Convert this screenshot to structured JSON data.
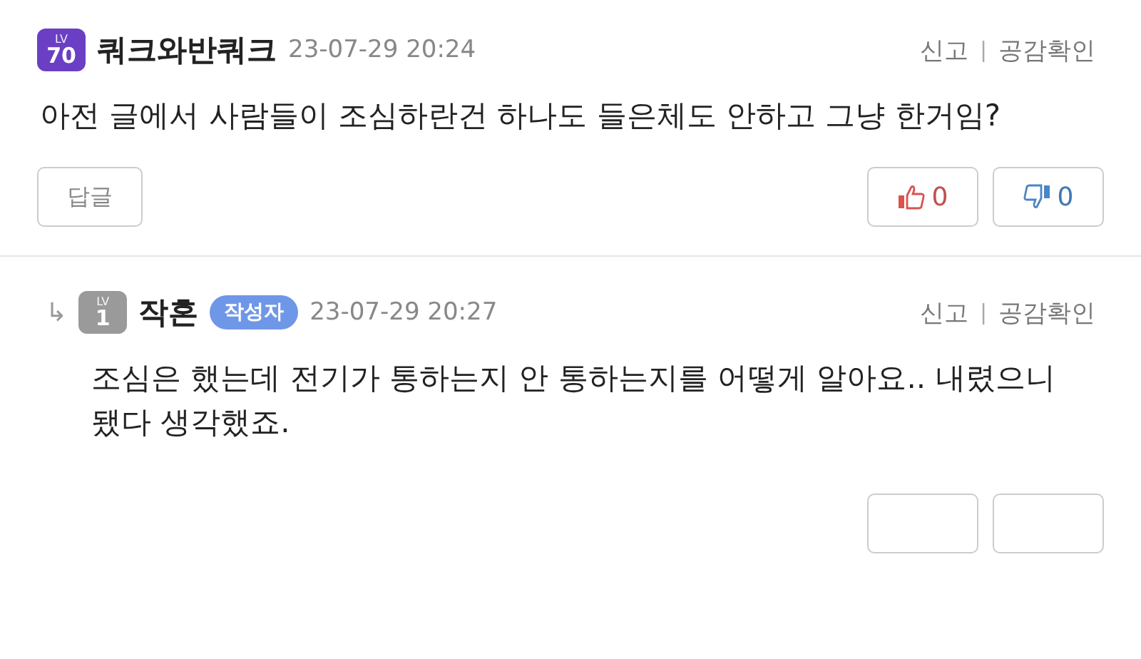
{
  "comments": [
    {
      "kind": "comment",
      "badge": {
        "label": "LV",
        "level": "70",
        "color": "#6a3fc4"
      },
      "author": "쿼크와반쿼크",
      "time": "23-07-29 20:24",
      "report": "신고",
      "separator": "|",
      "likes_check": "공감확인",
      "body": "아전 글에서 사람들이 조심하란건 하나도 들은체도 안하고 그냥 한거임?",
      "reply_button": "답글",
      "like_count": "0",
      "dislike_count": "0"
    },
    {
      "kind": "reply",
      "reply_arrow": "↳",
      "badge": {
        "label": "LV",
        "level": "1",
        "color": "#9a9a9a"
      },
      "author": "작혼",
      "author_tag": "작성자",
      "time": "23-07-29 20:27",
      "report": "신고",
      "separator": "|",
      "likes_check": "공감확인",
      "body": "조심은 했는데 전기가 통하는지 안 통하는지를 어떻게 알아요.. 내렸으니 됐다 생각했죠."
    }
  ]
}
